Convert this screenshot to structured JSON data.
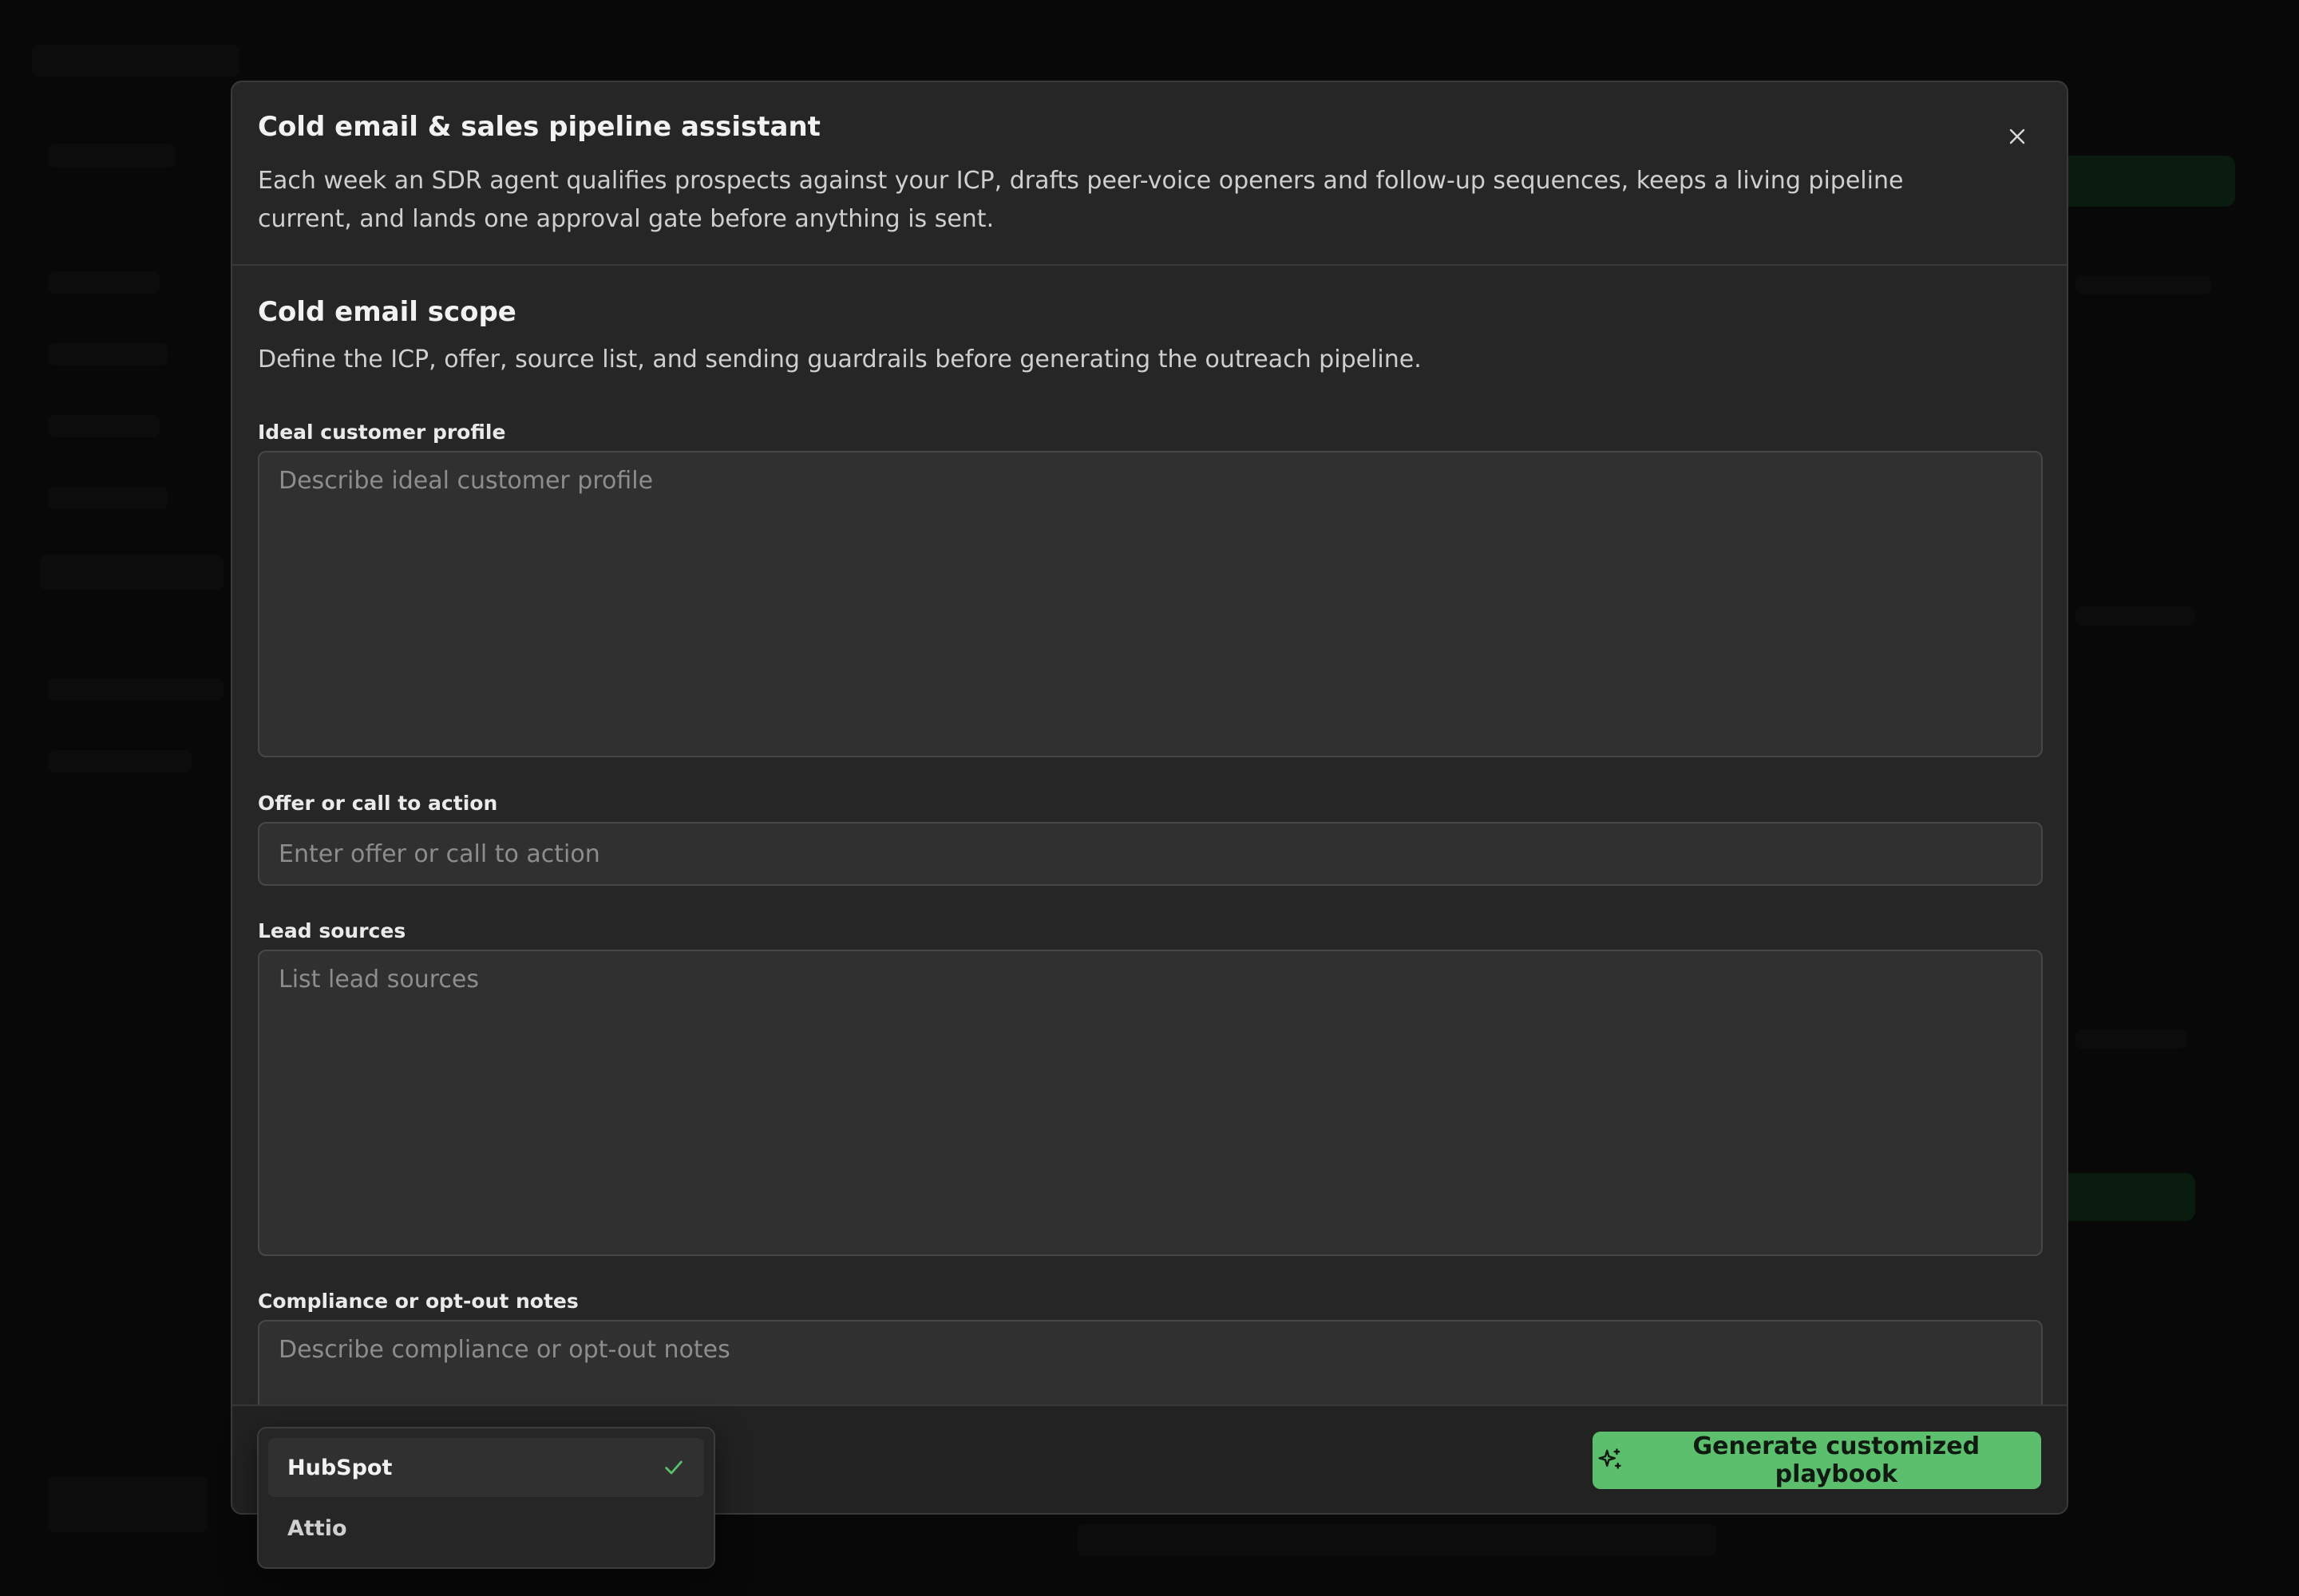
{
  "modal": {
    "title": "Cold email & sales pipeline assistant",
    "description": "Each week an SDR agent qualifies prospects against your ICP, drafts peer-voice openers and follow-up sequences, keeps a living pipeline current, and lands one approval gate before anything is sent."
  },
  "section": {
    "title": "Cold email scope",
    "description": "Define the ICP, offer, source list, and sending guardrails before generating the outreach pipeline."
  },
  "fields": {
    "icp": {
      "label": "Ideal customer profile",
      "placeholder": "Describe ideal customer profile",
      "value": ""
    },
    "offer": {
      "label": "Offer or call to action",
      "placeholder": "Enter offer or call to action",
      "value": ""
    },
    "lead_sources": {
      "label": "Lead sources",
      "placeholder": "List lead sources",
      "value": ""
    },
    "compliance": {
      "label": "Compliance or opt-out notes",
      "placeholder": "Describe compliance or opt-out notes",
      "value": ""
    }
  },
  "crm_dropdown": {
    "options": [
      {
        "label": "HubSpot",
        "selected": true
      },
      {
        "label": "Attio",
        "selected": false
      }
    ]
  },
  "footer": {
    "generate_label": "Generate customized playbook"
  },
  "colors": {
    "accent": "#5cbf6e",
    "modal_bg": "#262626",
    "field_bg": "#303030"
  }
}
